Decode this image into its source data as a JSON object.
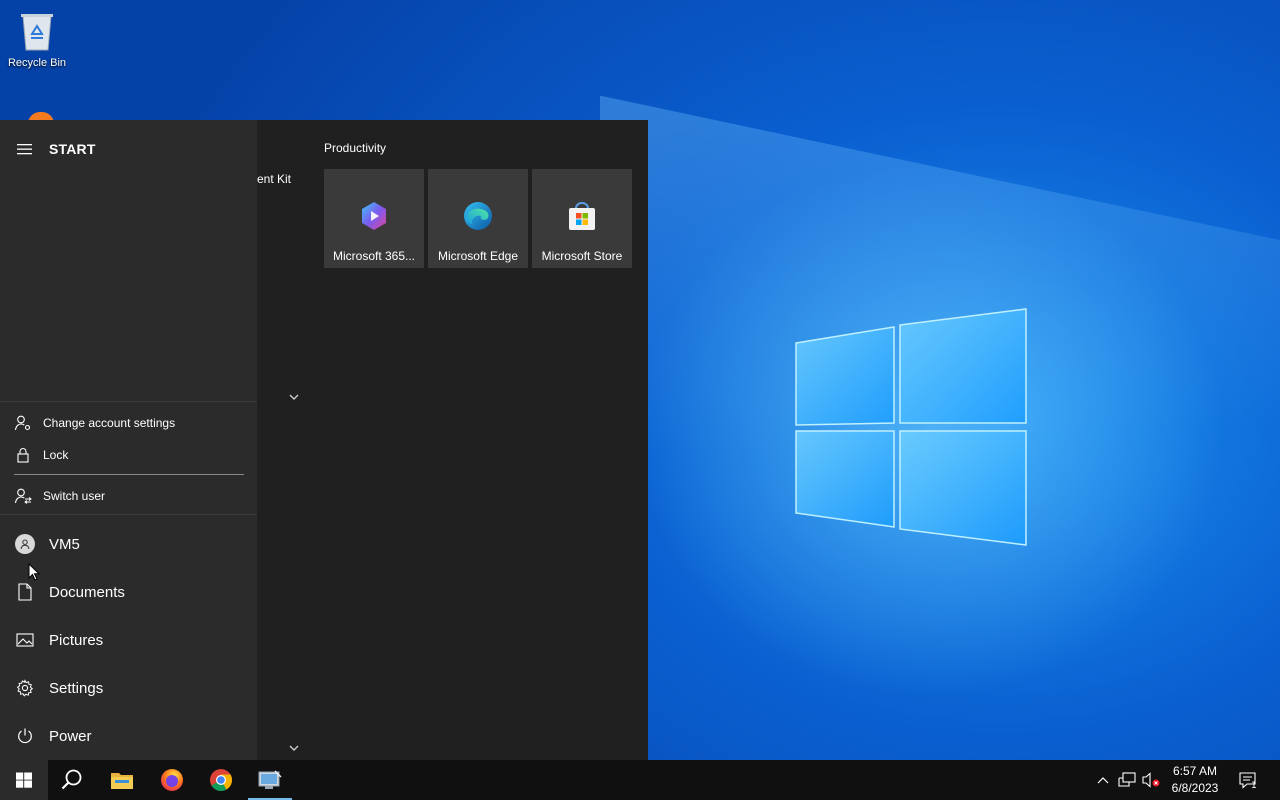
{
  "desktop": {
    "recycle_bin_label": "Recycle Bin"
  },
  "start_menu": {
    "title": "START",
    "app_list_fragment": "ent Kit",
    "account_flyout": {
      "items": [
        {
          "label": "Change account settings",
          "icon": "user-gear-icon"
        },
        {
          "label": "Lock",
          "icon": "lock-icon"
        },
        {
          "label": "Switch user",
          "icon": "switch-user-icon"
        }
      ]
    },
    "rail": {
      "user": "VM5",
      "documents": "Documents",
      "pictures": "Pictures",
      "settings": "Settings",
      "power": "Power"
    },
    "tile_group": {
      "title": "Productivity",
      "tiles": [
        {
          "label": "Microsoft 365...",
          "icon": "microsoft-365-icon"
        },
        {
          "label": "Microsoft Edge",
          "icon": "edge-icon"
        },
        {
          "label": "Microsoft Store",
          "icon": "store-icon"
        }
      ]
    }
  },
  "taskbar": {
    "apps": [
      "start-icon",
      "search-icon",
      "file-explorer-icon",
      "firefox-icon",
      "chrome-icon",
      "remote-desktop-icon"
    ],
    "clock": {
      "time": "6:57 AM",
      "date": "6/8/2023"
    },
    "notification_count": "1"
  },
  "colors": {
    "accent": "#76b9ed",
    "menu_bg": "#202020",
    "rail_bg": "#2b2b2b",
    "tile_bg": "#3a3a3a",
    "taskbar_bg": "#101010"
  }
}
